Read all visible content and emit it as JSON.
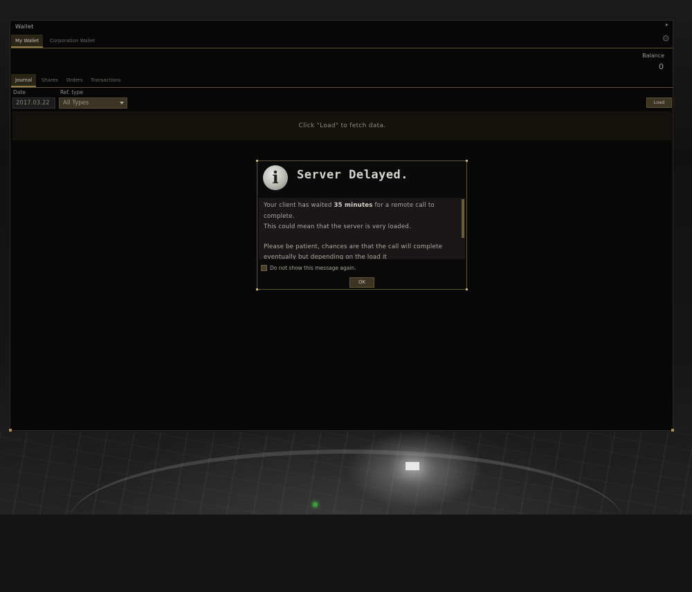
{
  "window": {
    "title": "Wallet",
    "close_glyph": "▸",
    "settings_icon": "gear-icon"
  },
  "main_tabs": [
    {
      "label": "My Wallet",
      "active": true
    },
    {
      "label": "Corporation Wallet",
      "active": false
    }
  ],
  "balance": {
    "label": "Balance",
    "value": "0"
  },
  "sub_tabs": [
    {
      "label": "Journal",
      "active": true
    },
    {
      "label": "Shares",
      "active": false
    },
    {
      "label": "Orders",
      "active": false
    },
    {
      "label": "Transactions",
      "active": false
    }
  ],
  "filters": {
    "date_label": "Date",
    "date_value": "2017.03.22",
    "ref_type_label": "Ref. type",
    "ref_type_value": "All Types",
    "load_label": "Load"
  },
  "journal": {
    "empty_message": "Click \"Load\" to fetch data."
  },
  "dialog": {
    "icon": "info-icon",
    "title": "Server Delayed.",
    "message_part1": "Your client has waited ",
    "message_bold": "35 minutes",
    "message_part2": " for a remote call to complete.",
    "message_line2": "This could mean that the server is very loaded.",
    "message_para2": "Please be patient, chances are that the call will complete eventually but depending on the load it",
    "checkbox_label": "Do not show this message again.",
    "ok_label": "OK"
  },
  "colors": {
    "accent": "#8a7846",
    "button_bg": "#3d3524",
    "window_bg": "#070707"
  }
}
